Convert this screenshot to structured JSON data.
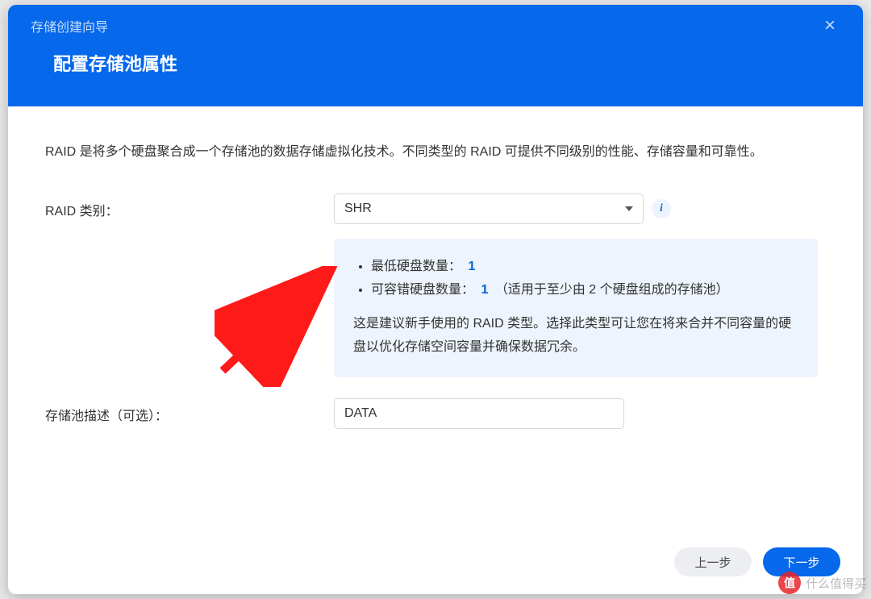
{
  "header": {
    "wizard_title": "存储创建向导",
    "page_title": "配置存储池属性",
    "close_label": "×"
  },
  "intro": "RAID 是将多个硬盘聚合成一个存储池的数据存储虚拟化技术。不同类型的 RAID 可提供不同级别的性能、存储容量和可靠性。",
  "raid": {
    "label": "RAID 类别：",
    "selected": "SHR",
    "info_icon": "i",
    "info": {
      "min_disks_label": "最低硬盘数量：",
      "min_disks_value": "1",
      "fault_label": "可容错硬盘数量：",
      "fault_value": "1",
      "fault_note": "（适用于至少由 2 个硬盘组成的存储池）",
      "description": "这是建议新手使用的 RAID 类型。选择此类型可让您在将来合并不同容量的硬盘以优化存储空间容量并确保数据冗余。"
    }
  },
  "desc": {
    "label": "存储池描述（可选）：",
    "value": "DATA"
  },
  "footer": {
    "prev": "上一步",
    "next": "下一步"
  },
  "watermark": {
    "badge": "值",
    "text": "什么值得买"
  }
}
